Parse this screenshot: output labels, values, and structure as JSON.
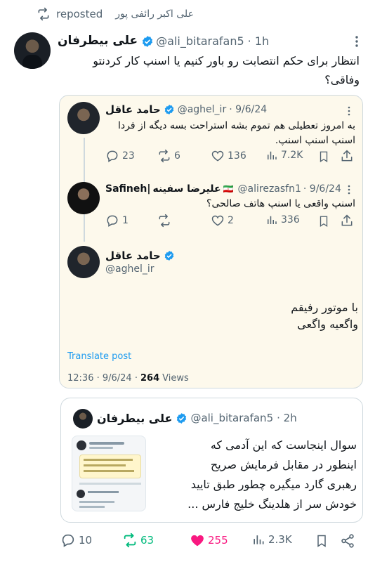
{
  "repost": {
    "label": "reposted",
    "reposter": "علی اکبر رائفی پور"
  },
  "main_tweet": {
    "display_name": "علی بیطرفان",
    "handle": "@ali_bitarafan5",
    "time": "· 1h",
    "text_line1": "انتظار برای حکم انتصابت رو باور کنیم یا اسنپ کار کردنتو",
    "text_line2": "وفاقی؟"
  },
  "quote": {
    "tweet1": {
      "display_name": "حامد عاقل",
      "handle": "@aghel_ir",
      "time": "· 9/6/24",
      "text_line1": "به امروز تعطیلی هم تموم بشه استراحت بسه دیگه از فردا",
      "text_line2": "اسنپ اسنپ اسنپ.",
      "replies": "23",
      "reposts": "6",
      "likes": "136",
      "views": "7.2K"
    },
    "tweet2": {
      "display_name_en": "Safineh|",
      "display_name_fa": "علیرضا سفینه",
      "flag": "🇮🇷",
      "handle": "@alirezasfn1",
      "time": "· 9/6/24",
      "text": "اسنپ واقعی یا اسنپ هاتف صالحی؟",
      "replies": "1",
      "likes": "2",
      "views": "336"
    },
    "tweet3": {
      "display_name": "حامد عاقل",
      "handle": "@aghel_ir",
      "text_line1": "با موتور رفیقم",
      "text_line2": "واگعیه واگعی",
      "translate": "Translate post",
      "timestamp": "12:36 · 9/6/24 ·",
      "views_count": "264",
      "views_label": "Views"
    }
  },
  "quote2": {
    "display_name": "علی بیطرفان",
    "handle": "@ali_bitarafan5",
    "time": "· 2h",
    "text_line1": "سوال اینجاست که این آدمی که",
    "text_line2": "اینطور در مقابل فرمایش صریح",
    "text_line3": "رهبری گارد میگیره چطور طبق تایید",
    "text_line4": "خودش سر از هلدینگ خلیج فارس ..."
  },
  "actions": {
    "replies": "10",
    "reposts": "63",
    "likes": "255",
    "views": "2.3K"
  },
  "colors": {
    "verified": "#1d9bf0",
    "link": "#1d9bf0",
    "repost_active": "#00ba7c",
    "like_active": "#f91880",
    "quote_bg": "#fdf9ec",
    "muted": "#536471"
  }
}
